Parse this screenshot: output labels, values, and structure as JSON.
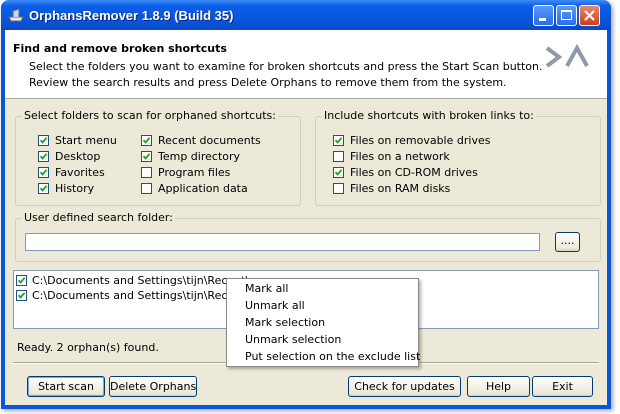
{
  "window": {
    "title": "OrphansRemover 1.8.9 (Build 35)",
    "accent": "#0a56d6"
  },
  "header": {
    "title": "Find and remove broken shortcuts",
    "line1": "Select the folders you want to examine for broken shortcuts and press the Start Scan button.",
    "line2": "Review the search results and press Delete Orphans to remove them from the system."
  },
  "folders": {
    "legend": "Select folders to scan for orphaned shortcuts:",
    "items": [
      {
        "label": "Start menu",
        "checked": true
      },
      {
        "label": "Desktop",
        "checked": true
      },
      {
        "label": "Favorites",
        "checked": true
      },
      {
        "label": "History",
        "checked": true
      },
      {
        "label": "Recent documents",
        "checked": true
      },
      {
        "label": "Temp directory",
        "checked": true
      },
      {
        "label": "Program files",
        "checked": false
      },
      {
        "label": "Application data",
        "checked": false
      }
    ]
  },
  "broken": {
    "legend": "Include shortcuts with broken links to:",
    "items": [
      {
        "label": "Files on removable drives",
        "checked": true
      },
      {
        "label": "Files on a network",
        "checked": false
      },
      {
        "label": "Files on CD-ROM drives",
        "checked": true
      },
      {
        "label": "Files on RAM disks",
        "checked": false
      }
    ]
  },
  "user_folder": {
    "legend": "User defined search folder:",
    "value": "",
    "browse_label": "...."
  },
  "results": [
    {
      "path": "C:\\Documents and Settings\\tijn\\Recent\\",
      "checked": true
    },
    {
      "path": "C:\\Documents and Settings\\tijn\\Recent\\",
      "checked": true
    }
  ],
  "context_menu": [
    "Mark all",
    "Unmark all",
    "Mark selection",
    "Unmark selection",
    "Put selection on the exclude list"
  ],
  "status": "Ready. 2 orphan(s) found.",
  "buttons": {
    "start_scan": "Start scan",
    "delete_orphans": "Delete Orphans",
    "check_updates": "Check for updates",
    "help": "Help",
    "exit": "Exit"
  }
}
